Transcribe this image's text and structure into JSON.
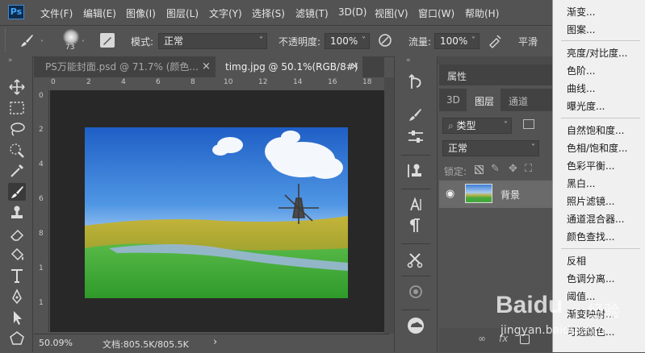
{
  "menubar": {
    "logo": "Ps",
    "items": [
      "文件(F)",
      "编辑(E)",
      "图像(I)",
      "图层(L)",
      "文字(Y)",
      "选择(S)",
      "滤镜(T)",
      "3D(D)",
      "视图(V)",
      "窗口(W)",
      "帮助(H)"
    ]
  },
  "options": {
    "brush_size": "73",
    "mode_label": "模式:",
    "mode_value": "正常",
    "opacity_label": "不透明度:",
    "opacity_value": "100%",
    "flow_label": "流量:",
    "flow_value": "100%",
    "smooth_label": "平滑"
  },
  "tabs": [
    {
      "label": "PS万能封面.psd @ 71.7% (颜色...",
      "close": "×"
    },
    {
      "label": "timg.jpg @ 50.1%(RGB/8#)",
      "close": "×"
    }
  ],
  "ruler": {
    "h_ticks": [
      "0",
      "2",
      "4",
      "6",
      "8",
      "10",
      "12",
      "14",
      "16",
      "18"
    ],
    "v_ticks": [
      "0",
      "2",
      "4",
      "6",
      "8",
      "1",
      "1"
    ]
  },
  "status": {
    "zoom": "50.09%",
    "doc": "文档:805.5K/805.5K",
    "arrow": "›"
  },
  "panel": {
    "properties_title": "属性",
    "tabs": [
      "3D",
      "图层",
      "通道"
    ],
    "filter_kind": "类型",
    "blend_mode": "正常",
    "lock_label": "锁定:",
    "layer_name": "背景"
  },
  "context_menu": {
    "group1": [
      "渐变...",
      "图案..."
    ],
    "group2": [
      "亮度/对比度...",
      "色阶...",
      "曲线...",
      "曝光度..."
    ],
    "group3": [
      "自然饱和度...",
      "色相/饱和度...",
      "色彩平衡...",
      "黑白...",
      "照片滤镜...",
      "通道混合器...",
      "颜色查找..."
    ],
    "group4": [
      "反相",
      "色调分离...",
      "阈值...",
      "渐变映射...",
      "可选颜色..."
    ]
  },
  "watermark": {
    "brand": "Baidu",
    "suffix": "经验",
    "url": "jingyan.baidu.com"
  },
  "colors": {
    "accent": "#3ea6ff",
    "sky": "#2a72d0",
    "grass": "#3fa83a"
  }
}
